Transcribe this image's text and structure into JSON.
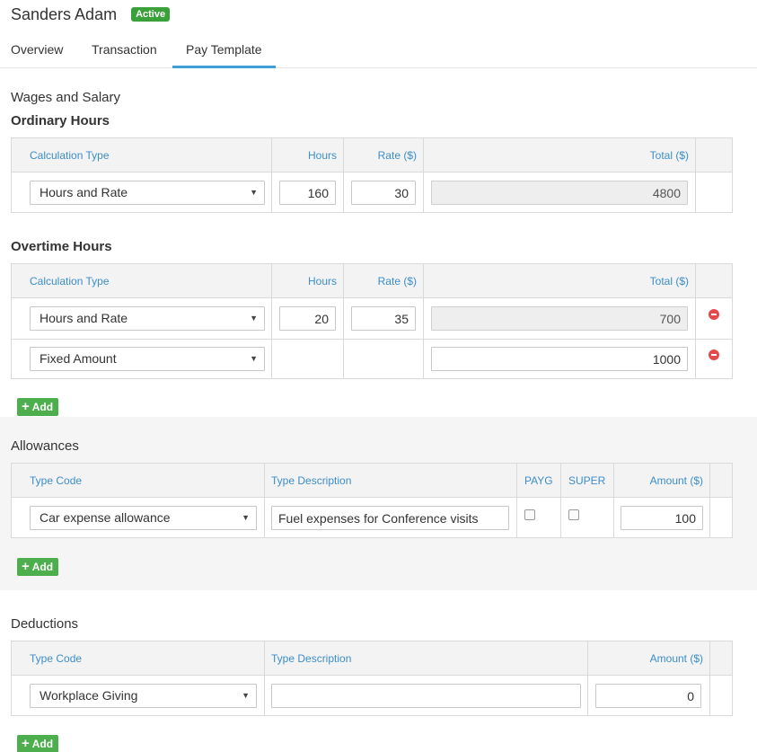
{
  "employee": {
    "name": "Sanders Adam",
    "status": "Active"
  },
  "tabs": [
    {
      "label": "Overview"
    },
    {
      "label": "Transaction"
    },
    {
      "label": "Pay Template"
    }
  ],
  "wages": {
    "title": "Wages and Salary",
    "ordinary": {
      "title": "Ordinary Hours",
      "headers": {
        "calc_type": "Calculation Type",
        "hours": "Hours",
        "rate": "Rate ($)",
        "total": "Total ($)"
      },
      "rows": [
        {
          "calc_type": "Hours and Rate",
          "hours": "160",
          "rate": "30",
          "total": "4800"
        }
      ]
    },
    "overtime": {
      "title": "Overtime Hours",
      "headers": {
        "calc_type": "Calculation Type",
        "hours": "Hours",
        "rate": "Rate ($)",
        "total": "Total ($)"
      },
      "rows": [
        {
          "calc_type": "Hours and Rate",
          "hours": "20",
          "rate": "35",
          "total": "700"
        },
        {
          "calc_type": "Fixed Amount",
          "total": "1000"
        }
      ],
      "add_label": "Add"
    }
  },
  "allowances": {
    "title": "Allowances",
    "headers": {
      "type_code": "Type Code",
      "type_desc": "Type Description",
      "payg": "PAYG",
      "super": "SUPER",
      "amount": "Amount ($)"
    },
    "rows": [
      {
        "type_code": "Car expense allowance",
        "type_desc": "Fuel expenses for Conference visits",
        "payg": false,
        "super": false,
        "amount": "100"
      }
    ],
    "add_label": "Add"
  },
  "deductions": {
    "title": "Deductions",
    "headers": {
      "type_code": "Type Code",
      "type_desc": "Type Description",
      "amount": "Amount ($)"
    },
    "rows": [
      {
        "type_code": "Workplace Giving",
        "type_desc": "",
        "amount": "0"
      }
    ],
    "add_label": "Add"
  },
  "colors": {
    "accent": "#3c9fd6",
    "header_text": "#3c8dc9",
    "add_button": "#4cae4c",
    "badge": "#3aa03a",
    "remove": "#e34a4a"
  }
}
